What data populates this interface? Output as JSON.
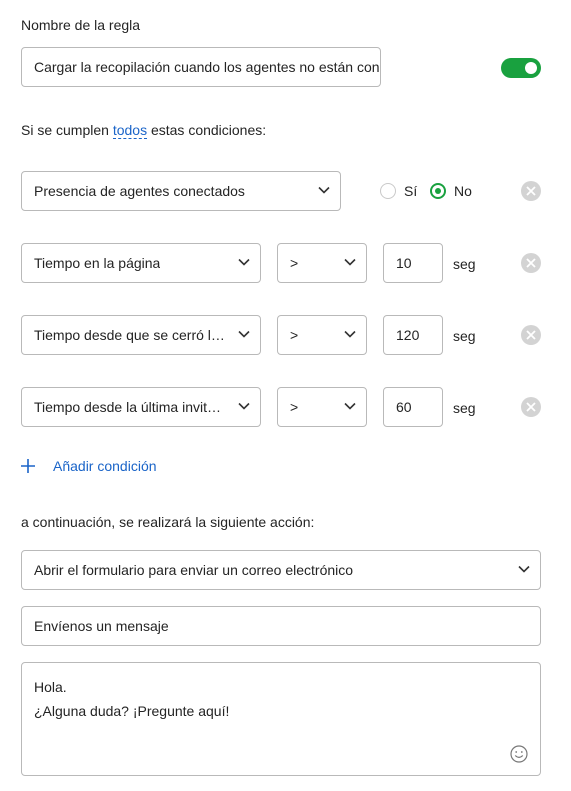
{
  "rule_name": {
    "label": "Nombre de la regla",
    "value": "Cargar la recopilación cuando los agentes no están con"
  },
  "enabled": true,
  "conditions_header": {
    "prefix": "Si se cumplen",
    "match": "todos",
    "suffix": "estas condiciones:"
  },
  "conditions": [
    {
      "field": "Presencia de agentes conectados",
      "options": [
        "Sí",
        "No"
      ],
      "selected": "No"
    },
    {
      "field": "Tiempo en la página",
      "operator": ">",
      "value": "10",
      "unit": "seg"
    },
    {
      "field": "Tiempo desde que se cerró la ...",
      "operator": ">",
      "value": "120",
      "unit": "seg"
    },
    {
      "field": "Tiempo desde la última invita...",
      "operator": ">",
      "value": "60",
      "unit": "seg"
    }
  ],
  "add_condition_label": "Añadir condición",
  "action": {
    "label": "a continuación, se realizará la siguiente acción:",
    "selected": "Abrir el formulario para enviar un correo electrónico",
    "subject": "Envíenos un mensaje",
    "message_line1": "Hola.",
    "message_line2": "¿Alguna duda? ¡Pregunte aquí!"
  },
  "colors": {
    "accent_green": "#19a13f",
    "link_blue": "#1a64c8"
  },
  "icons": [
    "chevron-down-icon",
    "close-icon",
    "plus-icon",
    "emoji-icon"
  ]
}
